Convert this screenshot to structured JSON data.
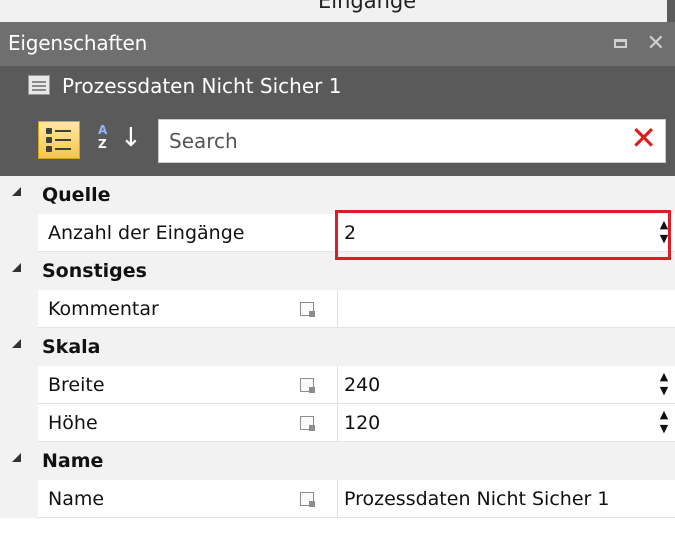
{
  "window": {
    "cut_text": "Eingänge"
  },
  "panel": {
    "title": "Eigenschaften",
    "maximize_icon": "maximize-icon",
    "close_icon": "close-icon",
    "close_glyph": "✕"
  },
  "object": {
    "title": "Prozessdaten Nicht Sicher 1",
    "icon": "object-icon"
  },
  "toolbar": {
    "categorized_icon": "categorized-view-icon",
    "sort_icon": "alphabetical-sort-icon",
    "sort_a": "A",
    "sort_z": "Z",
    "sort_arrow": "↓",
    "search_placeholder": "Search",
    "clear_glyph": "✕"
  },
  "grid": {
    "sections": [
      {
        "name": "Quelle",
        "properties": [
          {
            "label": "Anzahl der Eingänge",
            "value": "2",
            "marker": "diamond",
            "spinner": true,
            "highlighted": true
          }
        ]
      },
      {
        "name": "Sonstiges",
        "properties": [
          {
            "label": "Kommentar",
            "value": "",
            "marker": "edit",
            "spinner": false
          }
        ]
      },
      {
        "name": "Skala",
        "properties": [
          {
            "label": "Breite",
            "value": "240",
            "marker": "edit",
            "spinner": true
          },
          {
            "label": "Höhe",
            "value": "120",
            "marker": "edit",
            "spinner": true
          }
        ]
      },
      {
        "name": "Name",
        "properties": [
          {
            "label": "Name",
            "value": "Prozessdaten Nicht Sicher 1",
            "marker": "edit",
            "spinner": false
          }
        ]
      }
    ]
  },
  "glyphs": {
    "spin_up": "▲",
    "spin_down": "▼"
  },
  "colors": {
    "title_bar": "#6f6f6f",
    "header_bar": "#5a5a5a",
    "highlight": "#e01b24",
    "clear_x": "#e11a1a",
    "section_bg": "#f2f2f2"
  }
}
